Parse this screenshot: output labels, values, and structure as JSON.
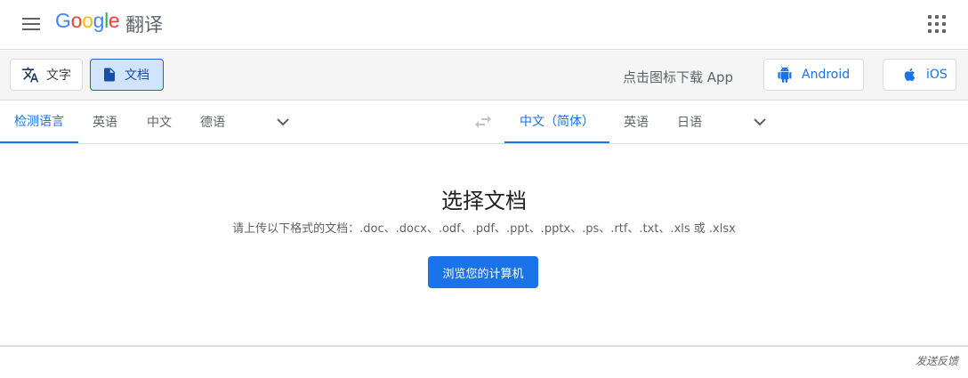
{
  "header": {
    "logo_letters": [
      "G",
      "o",
      "o",
      "g",
      "l",
      "e"
    ],
    "product_name": "翻译",
    "icons": {
      "menu": "menu-icon",
      "apps": "apps-grid-icon"
    }
  },
  "modebar": {
    "modes": [
      {
        "label": "文字",
        "icon": "translate-icon",
        "active": false
      },
      {
        "label": "文档",
        "icon": "document-icon",
        "active": true
      }
    ],
    "download_text": "点击图标下载 App",
    "stores": [
      {
        "label": "Android",
        "icon": "android-icon"
      },
      {
        "label": "iOS",
        "icon": "apple-icon"
      }
    ]
  },
  "source_languages": {
    "tabs": [
      "检测语言",
      "英语",
      "中文",
      "德语"
    ],
    "selected": "检测语言"
  },
  "target_languages": {
    "tabs": [
      "中文（简体）",
      "英语",
      "日语"
    ],
    "selected": "中文（简体）"
  },
  "main": {
    "title": "选择文档",
    "subtitle": "请上传以下格式的文档：.doc、.docx、.odf、.pdf、.ppt、.pptx、.ps、.rtf、.txt、.xls 或 .xlsx",
    "browse_label": "浏览您的计算机"
  },
  "footer": {
    "feedback": "发送反馈"
  },
  "colors": {
    "accent": "#1a73e8",
    "active_bg": "#d2e3fc",
    "border": "#dadce0"
  }
}
